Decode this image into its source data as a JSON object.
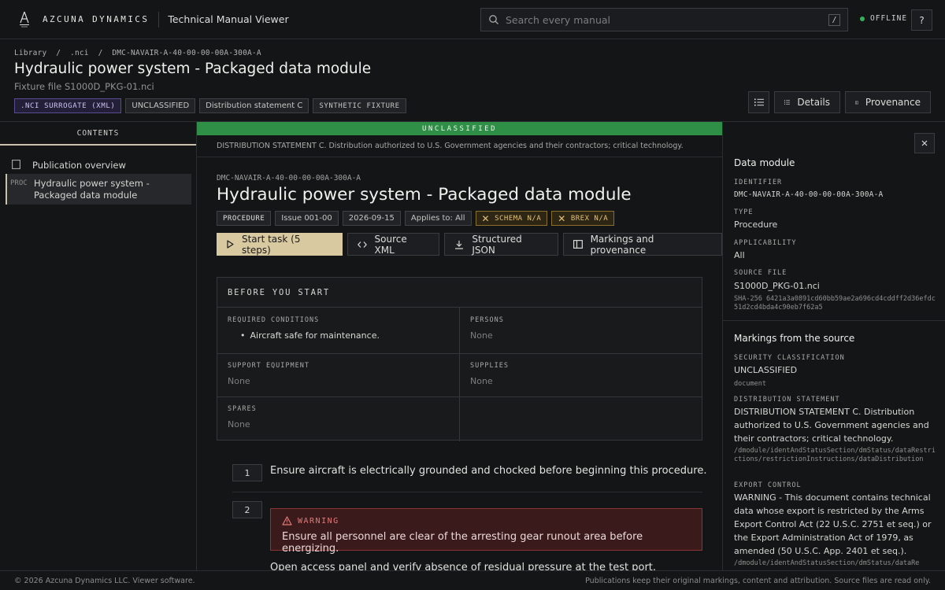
{
  "app": {
    "brand": "AZCUNA DYNAMICS",
    "title": "Technical Manual Viewer",
    "search_placeholder": "Search every manual",
    "search_shortcut": "/",
    "status": "OFFLINE",
    "help_label": "?"
  },
  "breadcrumb": {
    "items": [
      "Library",
      ".nci",
      "DMC-NAVAIR-A-40-00-00-00A-300A-A"
    ],
    "separator": "/"
  },
  "page": {
    "title": "Hydraulic power system - Packaged data module",
    "subtitle": "Fixture file S1000D_PKG-01.nci",
    "badges": [
      ".NCI SURROGATE (XML)",
      "UNCLASSIFIED",
      "Distribution statement C",
      "SYNTHETIC FIXTURE"
    ],
    "buttons": {
      "details": "Details",
      "provenance": "Provenance"
    }
  },
  "sidebar": {
    "heading": "CONTENTS",
    "items": [
      {
        "tag": "",
        "label": "Publication overview"
      },
      {
        "tag": "PROC",
        "label": "Hydraulic power system - Packaged data module"
      }
    ]
  },
  "main": {
    "classification_banner": "UNCLASSIFIED",
    "distribution_banner": "DISTRIBUTION STATEMENT C. Distribution authorized to U.S. Government agencies and their contractors; critical technology.",
    "dmc": "DMC-NAVAIR-A-40-00-00-00A-300A-A",
    "title": "Hydraulic power system - Packaged data module",
    "badges": {
      "type": "PROCEDURE",
      "issue": "Issue 001-00",
      "date": "2026-09-15",
      "applies": "Applies to: All",
      "schema": "SCHEMA N/A",
      "brex": "BREX N/A"
    },
    "actions": {
      "start": "Start task (5 steps)",
      "xml": "Source XML",
      "json": "Structured JSON",
      "markings": "Markings and provenance"
    },
    "before_you_start": {
      "heading": "BEFORE YOU START",
      "required_conditions_label": "REQUIRED CONDITIONS",
      "required_conditions": "Aircraft safe for maintenance.",
      "persons_label": "PERSONS",
      "persons": "None",
      "support_equipment_label": "SUPPORT EQUIPMENT",
      "support_equipment": "None",
      "supplies_label": "SUPPLIES",
      "supplies": "None",
      "spares_label": "SPARES",
      "spares": "None"
    },
    "steps": [
      {
        "number": "1",
        "text": "Ensure aircraft is electrically grounded and chocked before beginning this procedure."
      },
      {
        "number": "2",
        "warning_title": "WARNING",
        "warning_text": "Ensure all personnel are clear of the arresting gear runout area before energizing.",
        "text": "Open access panel and verify absence of residual pressure at the test port."
      }
    ]
  },
  "details_panel": {
    "data_module_heading": "Data module",
    "identifier_label": "IDENTIFIER",
    "identifier": "DMC-NAVAIR-A-40-00-00-00A-300A-A",
    "type_label": "TYPE",
    "type": "Procedure",
    "applicability_label": "APPLICABILITY",
    "applicability": "All",
    "source_file_label": "SOURCE FILE",
    "source_file": "S1000D_PKG-01.nci",
    "sha": "SHA-256 6421a3a0891cd60bb59ae2a696cd4cddff2d36efdc51d2cd4bda4c90eb7f62a5",
    "markings_heading": "Markings from the source",
    "security_label": "SECURITY CLASSIFICATION",
    "security": "UNCLASSIFIED",
    "security_source": "document",
    "distribution_label": "DISTRIBUTION STATEMENT",
    "distribution": "DISTRIBUTION STATEMENT C. Distribution authorized to U.S. Government agencies and their contractors; critical technology.",
    "distribution_source": "/dmodule/identAndStatusSection/dmStatus/dataRestrictions/restrictionInstructions/dataDistribution",
    "export_label": "EXPORT CONTROL",
    "export": "WARNING - This document contains technical data whose export is restricted by the Arms Export Control Act (22 U.S.C. 2751 et seq.) or the Export Administration Act of 1979, as amended (50 U.S.C. App. 2401 et seq.).",
    "export_source": "/dmodule/identAndStatusSection/dmStatus/dataRe"
  },
  "footer": {
    "left": "© 2026 Azcuna Dynamics LLC. Viewer software.",
    "right": "Publications keep their original markings, content and attribution. Source files are read only."
  },
  "colors": {
    "background": "#141517",
    "accent": "#d8c9a0",
    "classification_green": "#2f8f46",
    "warning_red": "#8a3434",
    "status_online_dot": "#35b05a"
  },
  "icons": [
    "azcuna-logo",
    "search-icon",
    "list-icon",
    "details-icon",
    "panel-icon",
    "bookmark-icon",
    "play-icon",
    "code-icon",
    "download-icon",
    "x-icon",
    "warning-icon",
    "close-icon"
  ]
}
